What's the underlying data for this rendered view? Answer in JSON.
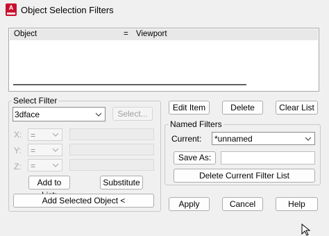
{
  "window": {
    "title": "Object Selection Filters",
    "icon_label": "A"
  },
  "list": {
    "headers": [
      "Object",
      "=",
      "Viewport"
    ]
  },
  "select_filter": {
    "group_label": "Select Filter",
    "object_type": "3dface",
    "select_button": "Select...",
    "axes": [
      {
        "label": "X:",
        "operator": "="
      },
      {
        "label": "Y:",
        "operator": "="
      },
      {
        "label": "Z:",
        "operator": "="
      }
    ],
    "add_to_list": "Add to List:",
    "substitute": "Substitute",
    "add_selected_object": "Add Selected Object <"
  },
  "actions": {
    "edit_item": "Edit Item",
    "delete": "Delete",
    "clear_list": "Clear List"
  },
  "named_filters": {
    "group_label": "Named Filters",
    "current_label": "Current:",
    "current_value": "*unnamed",
    "save_as": "Save As:",
    "delete_current": "Delete Current Filter List"
  },
  "footer": {
    "apply": "Apply",
    "cancel": "Cancel",
    "help": "Help"
  }
}
